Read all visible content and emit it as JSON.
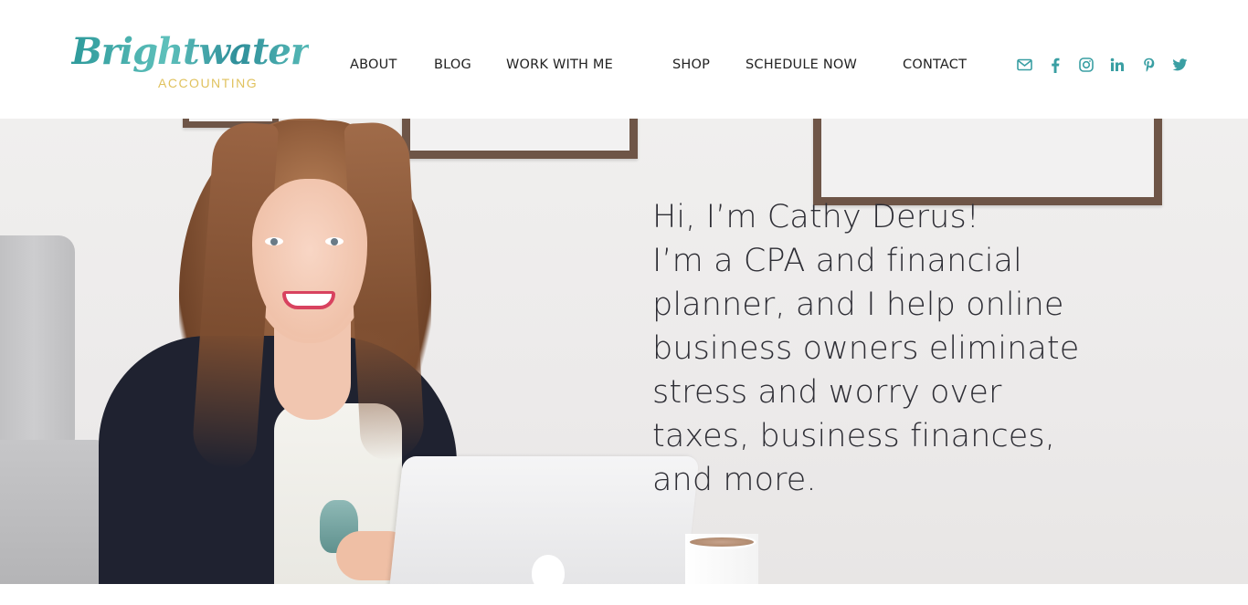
{
  "brand": {
    "logo_word": "Brightwater",
    "logo_sub": "ACCOUNTING",
    "accent_color": "#3a9fa3",
    "sub_color": "#e0c25e"
  },
  "nav": {
    "items": [
      {
        "label": "ABOUT"
      },
      {
        "label": "BLOG"
      },
      {
        "label": "WORK WITH ME"
      },
      {
        "label": "SHOP"
      },
      {
        "label": "SCHEDULE NOW"
      },
      {
        "label": "CONTACT"
      }
    ]
  },
  "socials": [
    {
      "icon": "email-icon"
    },
    {
      "icon": "facebook-icon"
    },
    {
      "icon": "instagram-icon"
    },
    {
      "icon": "linkedin-icon"
    },
    {
      "icon": "pinterest-icon"
    },
    {
      "icon": "twitter-icon"
    }
  ],
  "hero": {
    "lines": [
      "Hi, I’m Cathy Derus!",
      "I’m a CPA and financial",
      "planner, and I help online",
      "business owners eliminate",
      "stress and worry over",
      "taxes, business finances,",
      "and more."
    ]
  }
}
